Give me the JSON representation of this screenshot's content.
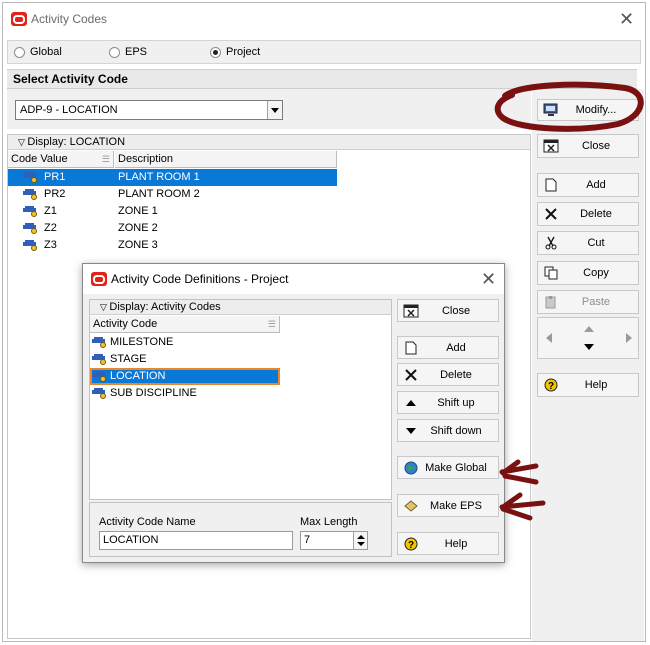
{
  "window": {
    "title": "Activity Codes"
  },
  "scope": {
    "options": [
      {
        "label": "Global",
        "selected": false
      },
      {
        "label": "EPS",
        "selected": false
      },
      {
        "label": "Project",
        "selected": true
      }
    ]
  },
  "select_section": {
    "heading": "Select Activity Code",
    "selected_code": "ADP-9 - LOCATION"
  },
  "grid": {
    "display_label": "Display: LOCATION",
    "columns": [
      "Code Value",
      "Description"
    ],
    "rows": [
      {
        "value": "PR1",
        "description": "PLANT ROOM 1",
        "selected": true
      },
      {
        "value": "PR2",
        "description": "PLANT ROOM 2",
        "selected": false
      },
      {
        "value": "Z1",
        "description": "ZONE 1",
        "selected": false
      },
      {
        "value": "Z2",
        "description": "ZONE 2",
        "selected": false
      },
      {
        "value": "Z3",
        "description": "ZONE 3",
        "selected": false
      }
    ]
  },
  "side_buttons": {
    "modify": "Modify...",
    "close": "Close",
    "add": "Add",
    "delete": "Delete",
    "cut": "Cut",
    "copy": "Copy",
    "paste": "Paste",
    "help": "Help"
  },
  "definitions_dialog": {
    "title": "Activity Code Definitions - Project",
    "display_label": "Display: Activity Codes",
    "column": "Activity Code",
    "rows": [
      {
        "name": "MILESTONE",
        "selected": false
      },
      {
        "name": "STAGE",
        "selected": false
      },
      {
        "name": "LOCATION",
        "selected": true
      },
      {
        "name": "SUB DISCIPLINE",
        "selected": false
      }
    ],
    "buttons": {
      "close": "Close",
      "add": "Add",
      "delete": "Delete",
      "shift_up": "Shift up",
      "shift_down": "Shift down",
      "make_global": "Make Global",
      "make_eps": "Make EPS",
      "help": "Help"
    },
    "name_label": "Activity Code Name",
    "name_value": "LOCATION",
    "max_length_label": "Max Length",
    "max_length_value": "7"
  },
  "colors": {
    "selection": "#0a78d7",
    "annotation": "#7a1111",
    "brand": "#e2231a"
  }
}
